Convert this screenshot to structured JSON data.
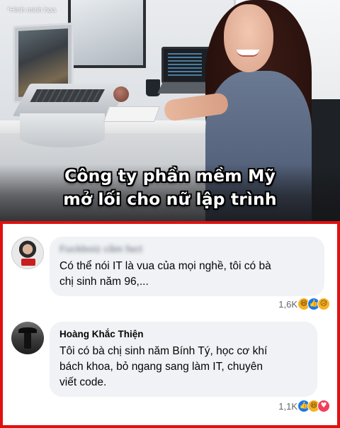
{
  "photo": {
    "watermark": "*Hình minh họa",
    "headline_line1": "Công ty phần mềm Mỹ",
    "headline_line2": "mở lối cho nữ lập trình"
  },
  "comments": [
    {
      "author": "Fuckboiz cầm fact",
      "text_line1": "Có thể nói IT là vua của mọi nghề, tôi có bà",
      "text_line2": "chị sinh năm 96,...",
      "reaction_count": "1,6K",
      "reactions": [
        "haha",
        "like",
        "sad"
      ]
    },
    {
      "author": "Hoàng Khắc Thiện",
      "text_line1": "Tôi có bà chị sinh năm Bính Tý, học cơ khí",
      "text_line2": "bách khoa, bỏ ngang sang làm IT, chuyên",
      "text_line3": "viết code.",
      "reaction_count": "1,1K",
      "reactions": [
        "like",
        "haha",
        "love"
      ]
    }
  ],
  "colors": {
    "frame_red": "#e01010",
    "bubble_bg": "#f0f2f5",
    "like_blue": "#1877f2",
    "love_red": "#f33e58",
    "haha_yellow": "#f7b125"
  },
  "icons": {
    "haha": "😆",
    "sad": "😥",
    "like": "👍",
    "love": "♥"
  }
}
